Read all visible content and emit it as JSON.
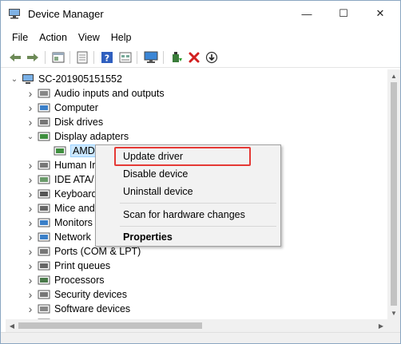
{
  "window": {
    "title": "Device Manager",
    "controls": {
      "minimize": "—",
      "maximize": "☐",
      "close": "✕"
    }
  },
  "menu": [
    "File",
    "Action",
    "View",
    "Help"
  ],
  "toolbar": {
    "icons": [
      "back-arrow-icon",
      "forward-arrow-icon",
      "properties-icon",
      "device-list-icon",
      "help-icon",
      "show-hide-icon",
      "monitor-scan-icon",
      "add-driver-icon",
      "remove-device-icon",
      "download-icon"
    ]
  },
  "tree": {
    "root": "SC-201905151552",
    "items": [
      {
        "label": "Audio inputs and outputs",
        "icon": "speaker-icon",
        "state": "collapsed"
      },
      {
        "label": "Computer",
        "icon": "computer-icon",
        "state": "collapsed"
      },
      {
        "label": "Disk drives",
        "icon": "disk-icon",
        "state": "collapsed"
      },
      {
        "label": "Display adapters",
        "icon": "display-adapter-icon",
        "state": "expanded"
      },
      {
        "label": "AMD",
        "icon": "display-adapter-icon",
        "state": "child",
        "selected": true
      },
      {
        "label": "Human Ir",
        "icon": "hid-icon",
        "state": "collapsed"
      },
      {
        "label": "IDE ATA/",
        "icon": "ide-icon",
        "state": "collapsed"
      },
      {
        "label": "Keyboard",
        "icon": "keyboard-icon",
        "state": "collapsed"
      },
      {
        "label": "Mice and",
        "icon": "mouse-icon",
        "state": "collapsed"
      },
      {
        "label": "Monitors",
        "icon": "monitor-icon",
        "state": "collapsed"
      },
      {
        "label": "Network",
        "icon": "network-icon",
        "state": "collapsed"
      },
      {
        "label": "Ports (COM & LPT)",
        "icon": "port-icon",
        "state": "collapsed"
      },
      {
        "label": "Print queues",
        "icon": "printer-icon",
        "state": "collapsed"
      },
      {
        "label": "Processors",
        "icon": "processor-icon",
        "state": "collapsed"
      },
      {
        "label": "Security devices",
        "icon": "security-icon",
        "state": "collapsed"
      },
      {
        "label": "Software devices",
        "icon": "software-icon",
        "state": "collapsed"
      },
      {
        "label": "",
        "icon": "sound-icon",
        "state": "collapsed"
      }
    ]
  },
  "context_menu": {
    "update": "Update driver",
    "disable": "Disable device",
    "uninstall": "Uninstall device",
    "scan": "Scan for hardware changes",
    "properties": "Properties"
  },
  "colors": {
    "highlight_border": "#e53935",
    "selection_bg": "#cce8ff",
    "menu_bg": "#f2f2f2"
  }
}
